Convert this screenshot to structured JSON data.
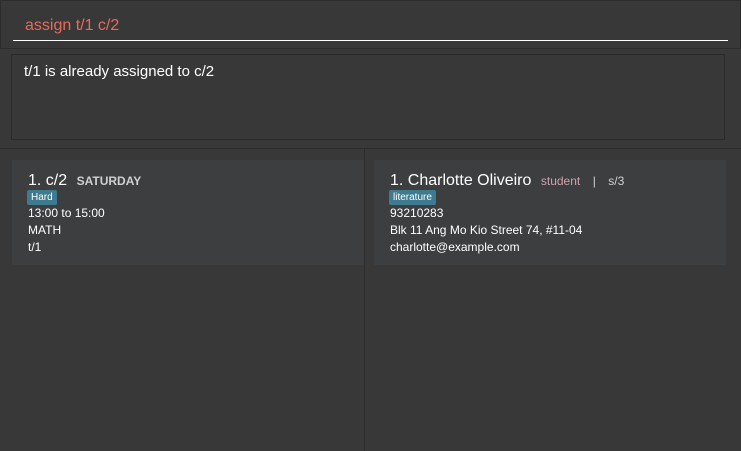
{
  "command": {
    "value": "assign t/1 c/2"
  },
  "result": {
    "message": "t/1 is already assigned to c/2"
  },
  "classes": [
    {
      "index": "1.",
      "code": "c/2",
      "day": "SATURDAY",
      "difficulty": "Hard",
      "time": "13:00 to 15:00",
      "subject": "MATH",
      "tutor": "t/1"
    }
  ],
  "persons": [
    {
      "index": "1.",
      "name": "Charlotte Oliveiro",
      "role": "student",
      "separator": "|",
      "id": "s/3",
      "tag": "literature",
      "phone": "93210283",
      "address": "Blk 11 Ang Mo Kio Street 74, #11-04",
      "email": "charlotte@example.com"
    }
  ],
  "colors": {
    "background": "#383838",
    "card": "#3c3e3f",
    "command_text": "#e86b5a",
    "tag": "#3e7b91",
    "role": "#d4a0ac"
  }
}
